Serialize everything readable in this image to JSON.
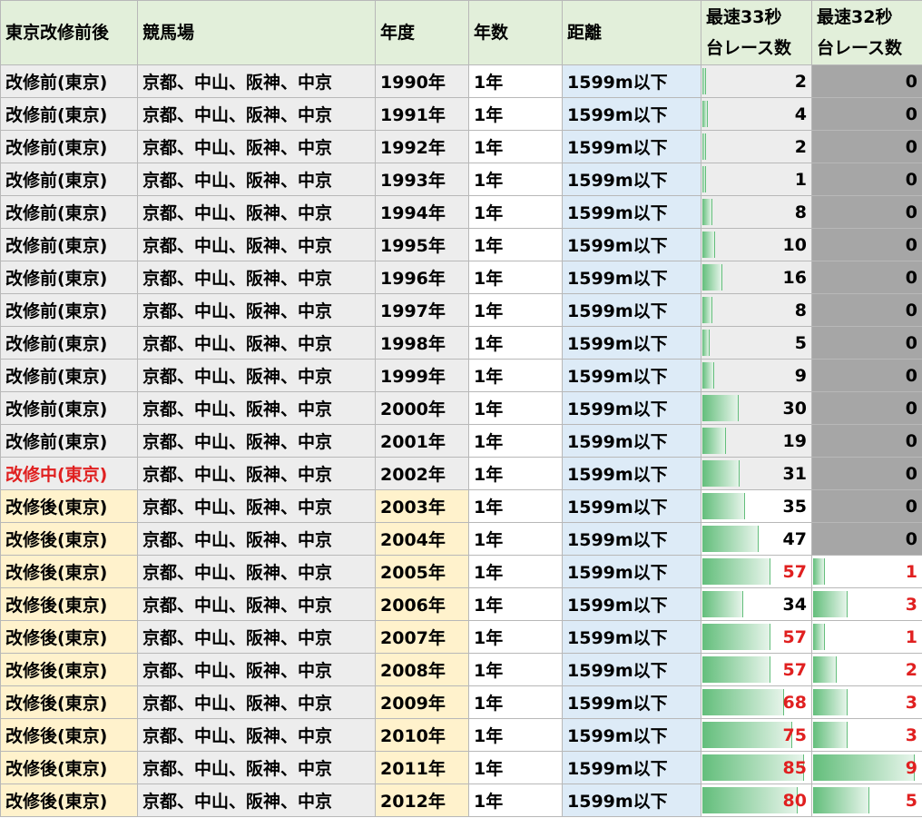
{
  "headers": {
    "status": "東京改修前後",
    "course": "競馬場",
    "year": "年度",
    "duration": "年数",
    "distance": "距離",
    "r33_line1": "最速33秒",
    "r33_line2": "台レース数",
    "r32_line1": "最速32秒",
    "r32_line2": "台レース数"
  },
  "colors": {
    "header_bg": "#e2efda",
    "before_bg": "#ededed",
    "after_bg": "#fff2cc",
    "distance_bg": "#ddebf7",
    "r32_zero_bg": "#a6a6a6",
    "databar_green": "#63be7b",
    "highlight_red": "#e02020"
  },
  "bar_max": {
    "r33": 85,
    "r32": 9
  },
  "rows": [
    {
      "status": "改修前(東京)",
      "phase": "before",
      "course": "京都、中山、阪神、中京",
      "year": "1990年",
      "duration": "1年",
      "distance": "1599m以下",
      "r33": 2,
      "r32": 0
    },
    {
      "status": "改修前(東京)",
      "phase": "before",
      "course": "京都、中山、阪神、中京",
      "year": "1991年",
      "duration": "1年",
      "distance": "1599m以下",
      "r33": 4,
      "r32": 0
    },
    {
      "status": "改修前(東京)",
      "phase": "before",
      "course": "京都、中山、阪神、中京",
      "year": "1992年",
      "duration": "1年",
      "distance": "1599m以下",
      "r33": 2,
      "r32": 0
    },
    {
      "status": "改修前(東京)",
      "phase": "before",
      "course": "京都、中山、阪神、中京",
      "year": "1993年",
      "duration": "1年",
      "distance": "1599m以下",
      "r33": 1,
      "r32": 0
    },
    {
      "status": "改修前(東京)",
      "phase": "before",
      "course": "京都、中山、阪神、中京",
      "year": "1994年",
      "duration": "1年",
      "distance": "1599m以下",
      "r33": 8,
      "r32": 0
    },
    {
      "status": "改修前(東京)",
      "phase": "before",
      "course": "京都、中山、阪神、中京",
      "year": "1995年",
      "duration": "1年",
      "distance": "1599m以下",
      "r33": 10,
      "r32": 0
    },
    {
      "status": "改修前(東京)",
      "phase": "before",
      "course": "京都、中山、阪神、中京",
      "year": "1996年",
      "duration": "1年",
      "distance": "1599m以下",
      "r33": 16,
      "r32": 0
    },
    {
      "status": "改修前(東京)",
      "phase": "before",
      "course": "京都、中山、阪神、中京",
      "year": "1997年",
      "duration": "1年",
      "distance": "1599m以下",
      "r33": 8,
      "r32": 0
    },
    {
      "status": "改修前(東京)",
      "phase": "before",
      "course": "京都、中山、阪神、中京",
      "year": "1998年",
      "duration": "1年",
      "distance": "1599m以下",
      "r33": 5,
      "r32": 0
    },
    {
      "status": "改修前(東京)",
      "phase": "before",
      "course": "京都、中山、阪神、中京",
      "year": "1999年",
      "duration": "1年",
      "distance": "1599m以下",
      "r33": 9,
      "r32": 0
    },
    {
      "status": "改修前(東京)",
      "phase": "before",
      "course": "京都、中山、阪神、中京",
      "year": "2000年",
      "duration": "1年",
      "distance": "1599m以下",
      "r33": 30,
      "r32": 0
    },
    {
      "status": "改修前(東京)",
      "phase": "before",
      "course": "京都、中山、阪神、中京",
      "year": "2001年",
      "duration": "1年",
      "distance": "1599m以下",
      "r33": 19,
      "r32": 0
    },
    {
      "status": "改修中(東京)",
      "phase": "during",
      "course": "京都、中山、阪神、中京",
      "year": "2002年",
      "duration": "1年",
      "distance": "1599m以下",
      "r33": 31,
      "r32": 0
    },
    {
      "status": "改修後(東京)",
      "phase": "after",
      "course": "京都、中山、阪神、中京",
      "year": "2003年",
      "duration": "1年",
      "distance": "1599m以下",
      "r33": 35,
      "r32": 0
    },
    {
      "status": "改修後(東京)",
      "phase": "after",
      "course": "京都、中山、阪神、中京",
      "year": "2004年",
      "duration": "1年",
      "distance": "1599m以下",
      "r33": 47,
      "r32": 0
    },
    {
      "status": "改修後(東京)",
      "phase": "after",
      "course": "京都、中山、阪神、中京",
      "year": "2005年",
      "duration": "1年",
      "distance": "1599m以下",
      "r33": 57,
      "r32": 1
    },
    {
      "status": "改修後(東京)",
      "phase": "after",
      "course": "京都、中山、阪神、中京",
      "year": "2006年",
      "duration": "1年",
      "distance": "1599m以下",
      "r33": 34,
      "r32": 3
    },
    {
      "status": "改修後(東京)",
      "phase": "after",
      "course": "京都、中山、阪神、中京",
      "year": "2007年",
      "duration": "1年",
      "distance": "1599m以下",
      "r33": 57,
      "r32": 1
    },
    {
      "status": "改修後(東京)",
      "phase": "after",
      "course": "京都、中山、阪神、中京",
      "year": "2008年",
      "duration": "1年",
      "distance": "1599m以下",
      "r33": 57,
      "r32": 2
    },
    {
      "status": "改修後(東京)",
      "phase": "after",
      "course": "京都、中山、阪神、中京",
      "year": "2009年",
      "duration": "1年",
      "distance": "1599m以下",
      "r33": 68,
      "r32": 3
    },
    {
      "status": "改修後(東京)",
      "phase": "after",
      "course": "京都、中山、阪神、中京",
      "year": "2010年",
      "duration": "1年",
      "distance": "1599m以下",
      "r33": 75,
      "r32": 3
    },
    {
      "status": "改修後(東京)",
      "phase": "after",
      "course": "京都、中山、阪神、中京",
      "year": "2011年",
      "duration": "1年",
      "distance": "1599m以下",
      "r33": 85,
      "r32": 9
    },
    {
      "status": "改修後(東京)",
      "phase": "after",
      "course": "京都、中山、阪神、中京",
      "year": "2012年",
      "duration": "1年",
      "distance": "1599m以下",
      "r33": 80,
      "r32": 5
    }
  ]
}
